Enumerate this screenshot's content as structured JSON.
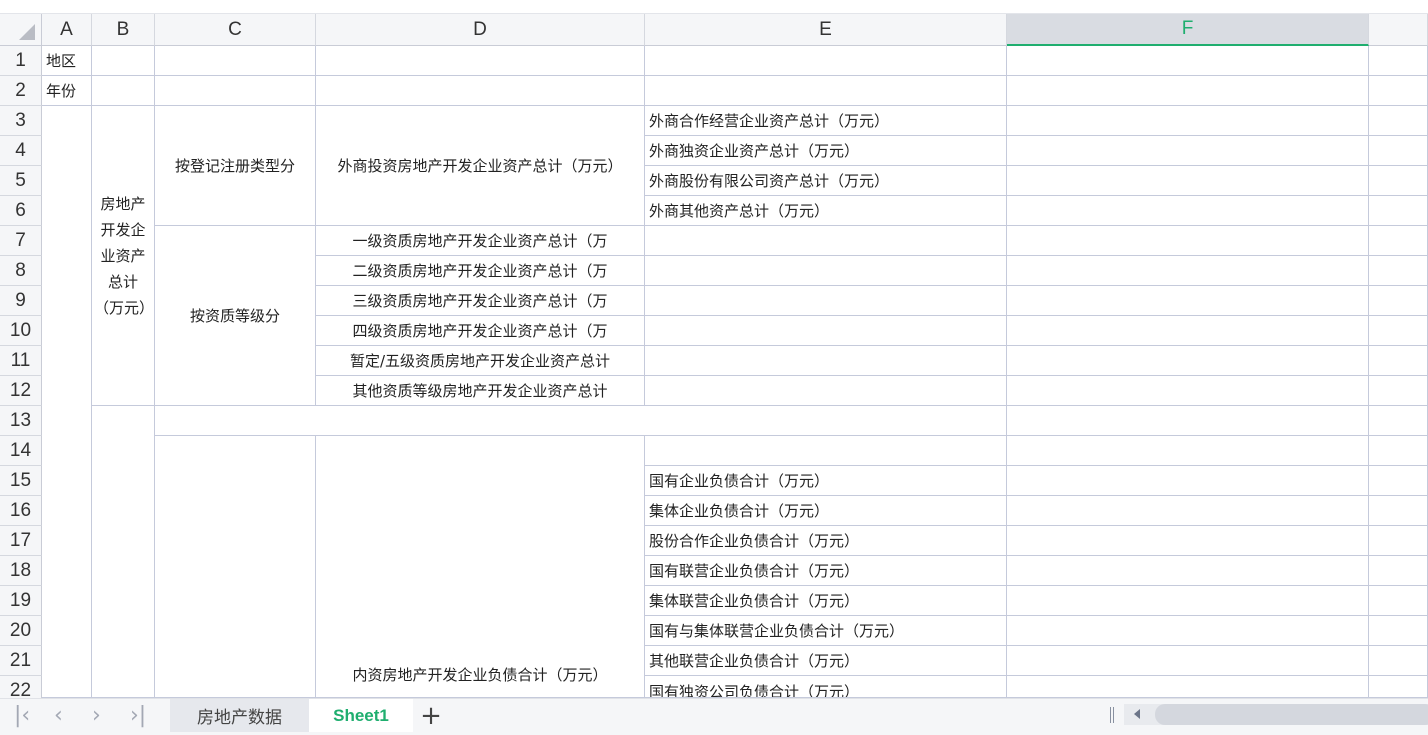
{
  "columns": [
    "A",
    "B",
    "C",
    "D",
    "E",
    "F"
  ],
  "selected_column": "F",
  "rows": [
    "1",
    "2",
    "3",
    "4",
    "5",
    "6",
    "7",
    "8",
    "9",
    "10",
    "11",
    "12",
    "13",
    "14",
    "15",
    "16",
    "17",
    "18",
    "19",
    "20",
    "21",
    "22"
  ],
  "cells": {
    "A1": "地区",
    "A2": "年份",
    "B3": "房地产开发企业资产总计（万元）",
    "C3": "按登记注册类型分",
    "D3": "外商投资房地产开发企业资产总计（万元）",
    "E3": "外商合作经营企业资产总计（万元）",
    "E4": "外商独资企业资产总计（万元）",
    "E5": "外商股份有限公司资产总计（万元）",
    "E6": "外商其他资产总计（万元）",
    "C7": "按资质等级分",
    "D7": "一级资质房地产开发企业资产总计（万",
    "D8": "二级资质房地产开发企业资产总计（万",
    "D9": "三级资质房地产开发企业资产总计（万",
    "D10": "四级资质房地产开发企业资产总计（万",
    "D11": "暂定/五级资质房地产开发企业资产总计",
    "D12": "其他资质等级房地产开发企业资产总计",
    "D14": "内资房地产开发企业负债合计（万元）",
    "E15": "国有企业负债合计（万元）",
    "E16": "集体企业负债合计（万元）",
    "E17": "股份合作企业负债合计（万元）",
    "E18": "国有联营企业负债合计（万元）",
    "E19": "集体联营企业负债合计（万元）",
    "E20": "国有与集体联营企业负债合计（万元）",
    "E21": "其他联营企业负债合计（万元）",
    "E22": "国有独资公司负债合计（万元）"
  },
  "sheet_tabs": [
    {
      "label": "房地产数据",
      "active": false
    },
    {
      "label": "Sheet1",
      "active": true
    }
  ],
  "add_sheet": "+",
  "colors": {
    "accent": "#1fae6f",
    "grid": "#c5cadb",
    "header_bg": "#f5f6f8"
  }
}
